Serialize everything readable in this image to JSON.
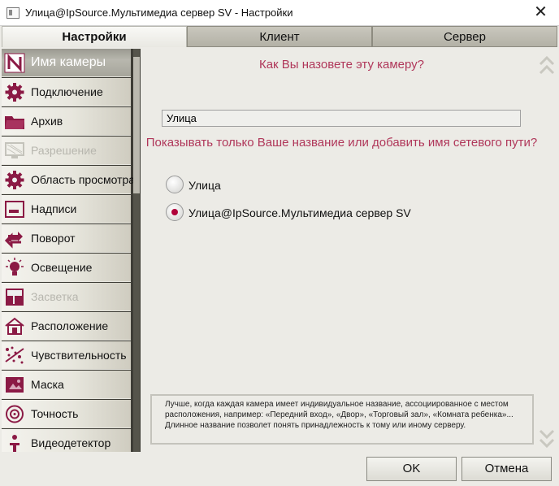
{
  "window": {
    "title": "Улица@IpSource.Мультимедиа сервер SV - Настройки",
    "close_glyph": "✕"
  },
  "tabs": [
    {
      "label": "Настройки",
      "active": true
    },
    {
      "label": "Клиент",
      "active": false
    },
    {
      "label": "Сервер",
      "active": false
    }
  ],
  "sidebar": {
    "items": [
      {
        "label": "Имя камеры",
        "icon": "n-logo-icon",
        "state": "selected"
      },
      {
        "label": "Подключение",
        "icon": "gear-icon",
        "state": "normal"
      },
      {
        "label": "Архив",
        "icon": "folder-icon",
        "state": "normal"
      },
      {
        "label": "Разрешение",
        "icon": "monitor-icon",
        "state": "disabled"
      },
      {
        "label": "Область просмотра",
        "icon": "gear-icon",
        "state": "normal"
      },
      {
        "label": "Надписи",
        "icon": "caption-icon",
        "state": "normal"
      },
      {
        "label": "Поворот",
        "icon": "rotate-icon",
        "state": "normal"
      },
      {
        "label": "Освещение",
        "icon": "bulb-icon",
        "state": "normal"
      },
      {
        "label": "Засветка",
        "icon": "grid-icon",
        "state": "disabled"
      },
      {
        "label": "Расположение",
        "icon": "house-icon",
        "state": "normal"
      },
      {
        "label": "Чувствительность",
        "icon": "sensitivity-icon",
        "state": "normal"
      },
      {
        "label": "Маска",
        "icon": "mask-icon",
        "state": "normal"
      },
      {
        "label": "Точность",
        "icon": "target-icon",
        "state": "normal"
      },
      {
        "label": "Видеодетектор",
        "icon": "person-icon",
        "state": "normal"
      }
    ]
  },
  "main": {
    "question": "Как Вы назовете эту камеру?",
    "name_value": "Улица",
    "question2": "Показывать только Ваше название или добавить имя сетевого пути?",
    "options": [
      {
        "label": "Улица",
        "checked": false
      },
      {
        "label": "Улица@IpSource.Мультимедиа сервер SV",
        "checked": true
      }
    ],
    "info": "Лучше, когда каждая камера имеет индивидуальное название, ассоциированное с местом расположения, например: «Передний вход», «Двор», «Торговый зал», «Комната ребенка»... Длинное название позволет понять принадлежность к тому или иному серверу."
  },
  "buttons": {
    "ok": "OK",
    "cancel": "Отмена"
  },
  "colors": {
    "accent": "#b0375a",
    "icon": "#8b1a45",
    "sidebar_bg": "#3e3d36"
  }
}
